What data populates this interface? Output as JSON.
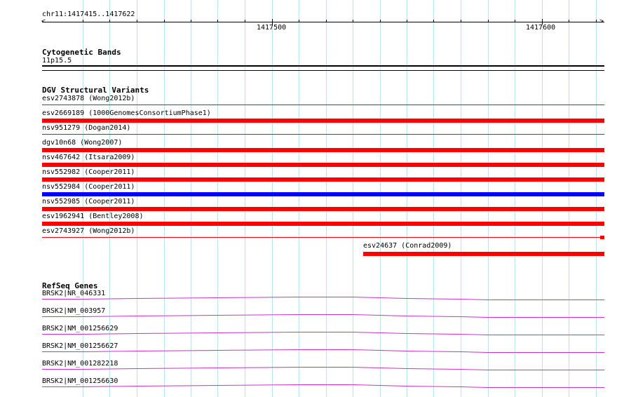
{
  "ruler": {
    "location": "chr11:1417415..1417622",
    "ticks": [
      "1417500",
      "1417600"
    ]
  },
  "cytoband": {
    "title": "Cytogenetic Bands",
    "band": "11p15.5"
  },
  "dgv": {
    "title": "DGV Structural Variants",
    "items": [
      {
        "label": "esv2743878 (Wong2012b)",
        "color": "#ff0000",
        "style": "thin"
      },
      {
        "label": "esv2669189 (1000GenomesConsortiumPhase1)",
        "color": "#ff0000",
        "style": "thick"
      },
      {
        "label": "nsv951279 (Dogan2014)",
        "color": "#ff0000",
        "style": "thin"
      },
      {
        "label": "dgv10n68 (Wong2007)",
        "color": "#ff0000",
        "style": "thick"
      },
      {
        "label": "nsv467642 (Itsara2009)",
        "color": "#ff0000",
        "style": "thick"
      },
      {
        "label": "nsv552982 (Cooper2011)",
        "color": "#ff0000",
        "style": "thick"
      },
      {
        "label": "nsv552984 (Cooper2011)",
        "color": "#0000ff",
        "style": "thick"
      },
      {
        "label": "nsv552985 (Cooper2011)",
        "color": "#ff0000",
        "style": "thick"
      },
      {
        "label": "esv1962941 (Bentley2008)",
        "color": "#ff0000",
        "style": "thick"
      },
      {
        "label": "esv2743927 (Wong2012b)",
        "color": "#ff0000",
        "style": "thin-end"
      },
      {
        "label": "esv24637 (Conrad2009)",
        "color": "#ff0000",
        "style": "partial"
      }
    ]
  },
  "refseq": {
    "title": "RefSeq Genes",
    "color": "#cc33cc",
    "items": [
      {
        "label": "BRSK2|NR_046331"
      },
      {
        "label": "BRSK2|NM_003957"
      },
      {
        "label": "BRSK2|NM_001256629"
      },
      {
        "label": "BRSK2|NM_001256627"
      },
      {
        "label": "BRSK2|NM_001282218"
      },
      {
        "label": "BRSK2|NM_001256630"
      }
    ]
  }
}
